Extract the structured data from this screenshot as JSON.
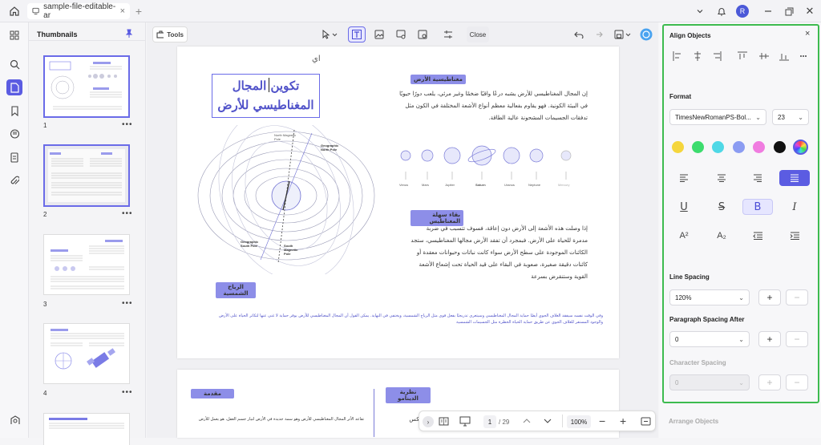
{
  "tab": {
    "title": "sample-file-editable-ar"
  },
  "user": {
    "initial": "R"
  },
  "thumbnails": {
    "title": "Thumbnails",
    "pages": [
      "1",
      "2",
      "3",
      "4"
    ],
    "more": "•••"
  },
  "toolbar": {
    "tools_label": "Tools",
    "close_label": "Close"
  },
  "page1": {
    "top_mark": "اي",
    "title_line1": "تكوين المجال",
    "title_line2": "المغناطيسي للأرض",
    "chip_magnetosphere": "مغناطيسية الأرض",
    "para1": "إن المجال المغناطيسي للأرض يشبه درعًا واقيًا ضخمًا وغير مرئي، يلعب دورًا حيويًا في البيئة الكونية. فهو يقاوم بفعالية معظم أنواع الأشعة المختلفة في الكون مثل تدفقات الجسيمات المشحونة عالية الطاقة.",
    "chip_field": "بقاء سهلة المغناطيس",
    "para2": "إذا وصلت هذه الأشعة إلى الأرض دون إعاقة، فسوف تتسبب في ضربة مدمرة للحياة على الأرض. فبمجرد أن تفقد الأرض مجالها المغناطيسي، ستجد الكائنات الموجودة على سطح الأرض سواء كانت نباتات وحيوانات معقدة أو كائنات دقيقة صغيرة، صعوبة في البقاء على قيد الحياة تحت إشعاع الأشعة القوية وستنقرض بسرعة",
    "chip_solar_wind": "الرياح الشمسية",
    "bottom_text": "وفي الوقت نفسه سيفقد الغلاف الجوي أيضًا حماية المجال المغناطيسي وسيتعرى تدريجيًا بفعل قوى مثل الرياح الشمسية، ويختفي في النهاية. يمكن القول أن المجال المغناطيسي للأرض يوفر حماية لا غنى عنها لتكاثر الحياة على الأرض والوجود المستقر للغلاف الجوي عن طريق حماية الحياة الخطرة مثل الجسيمات الشمسية",
    "diagram": {
      "north_magnetic": "North Magnetic Pole",
      "geo_north": "Geographic North Pole",
      "geo_south": "Geographic South Pole",
      "south_magnetic": "South Magnetic Pole"
    },
    "planets": [
      "Venus",
      "Mars",
      "Jupiter",
      "Saturn",
      "Uranus",
      "Neptune",
      "Mercury"
    ]
  },
  "page2": {
    "chip_intro": "مقدمة",
    "chip_dynamo": "نظرية الدينامو",
    "text_left": "تقاعد الأثر المجال المغناطيسي للأرض وهو سمة جديدة في الأرض لتيار جسم العقل، هو يعمل للأرض",
    "text_right": "الديناميكس"
  },
  "bottomnav": {
    "page": "1",
    "total": "/ 29",
    "zoom": "100%"
  },
  "right": {
    "align_title": "Align Objects",
    "format_title": "Format",
    "font_name": "TimesNewRomanPS-Bol...",
    "font_size": "23",
    "colors": [
      "#f5d63d",
      "#3ddc6e",
      "#4fd8e6",
      "#8b9cf2",
      "#f07ce0",
      "#111111"
    ],
    "line_spacing_title": "Line Spacing",
    "line_spacing_value": "120%",
    "para_spacing_title": "Paragraph Spacing After",
    "para_spacing_value": "0",
    "char_spacing_title": "Character Spacing",
    "char_spacing_value": "0",
    "arrange_title": "Arrange Objects",
    "plus": "+",
    "minus": "−"
  }
}
